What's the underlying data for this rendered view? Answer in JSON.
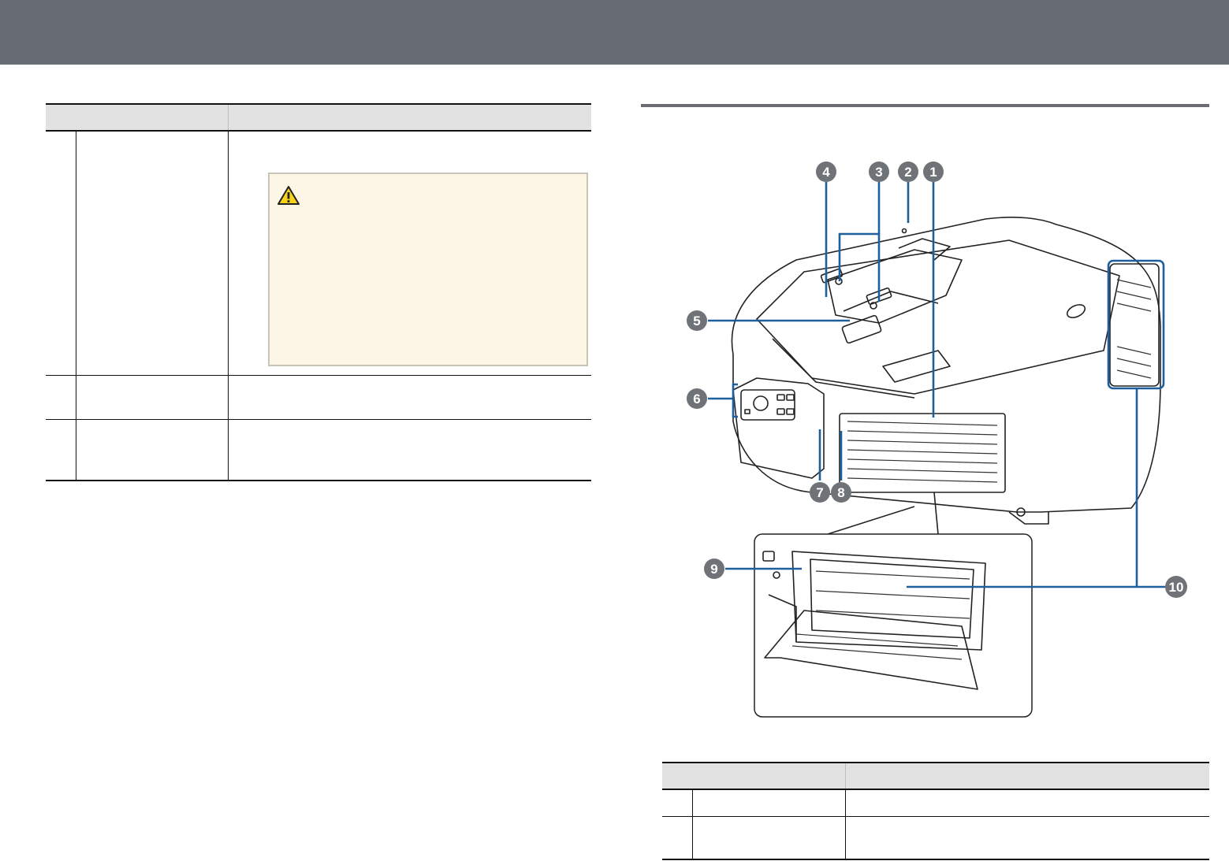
{
  "figure": {
    "callouts": [
      "1",
      "2",
      "3",
      "4",
      "5",
      "6",
      "7",
      "8",
      "9",
      "10"
    ]
  },
  "icons": {
    "warning": "warning-triangle-icon"
  },
  "colors": {
    "header_bar": "#686c73",
    "callout_fill": "#6f7378",
    "leader_line": "#1e5f9e",
    "warning_bg": "#fdf6e6"
  }
}
